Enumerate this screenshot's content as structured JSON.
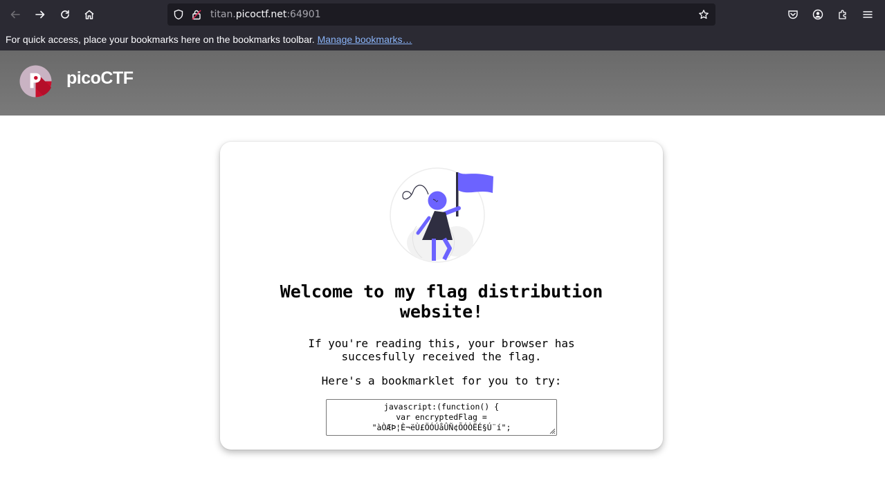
{
  "browser": {
    "url_host_prefix": "titan.",
    "url_domain": "picoctf.net",
    "url_port": ":64901",
    "bookmarks_message": "For quick access, place your bookmarks here on the bookmarks toolbar.",
    "manage_bookmarks_label": "Manage bookmarks…"
  },
  "site": {
    "brand": "picoCTF"
  },
  "card": {
    "title": "Welcome to my flag distribution website!",
    "paragraph1": "If you're reading this, your browser has succesfully received the flag.",
    "paragraph2": "Here's a bookmarklet for you to try:",
    "code_lines": [
      "javascript:(function() {",
      "var encryptedFlag =",
      "\"àÒÆÞ¦È¬ëÙ£ÖÓÚåÛÑ¢ÕÓÒËÉ§Ú¨í\";"
    ]
  },
  "colors": {
    "accent": "#6c63ff",
    "dark": "#2f2e41",
    "brand_red": "#c8102e",
    "brand_pink": "#c9b3c3"
  }
}
